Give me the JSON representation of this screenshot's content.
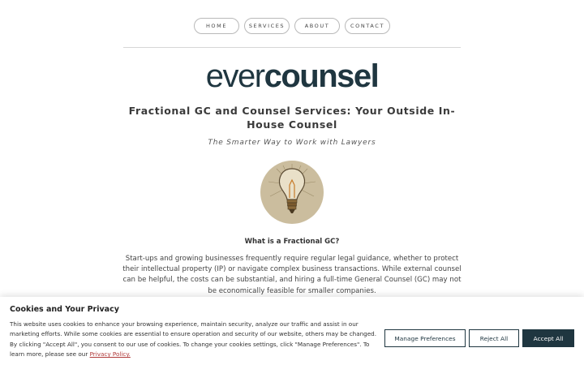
{
  "nav": {
    "home": "HOME",
    "services": "SERVICES",
    "about": "ABOUT",
    "contact": "CONTACT"
  },
  "logo": {
    "light": "ever",
    "bold": "counsel"
  },
  "hero": {
    "headline": "Fractional GC and Counsel Services: Your Outside In-House Counsel",
    "tagline": "The Smarter Way to Work with Lawyers"
  },
  "section": {
    "title": "What is a Fractional GC?",
    "body": "Start-ups and growing businesses frequently require regular legal guidance, whether to protect their intellectual property (IP) or navigate complex business transactions. While external counsel can be helpful, the costs can be substantial, and hiring a full-time General Counsel (GC) may not be economically feasible for smaller companies."
  },
  "cookie": {
    "title": "Cookies and Your Privacy",
    "text": "This website uses cookies to enhance your browsing experience, maintain security, analyze our traffic and assist in our marketing efforts. While some cookies are essential to ensure operation and security of our website, others may be changed. By clicking \"Accept All\", you consent to our use of cookies. To change your cookies settings, click \"Manage Preferences\". To learn more, please see our ",
    "link": "Privacy Policy.",
    "manage": "Manage Preferences",
    "reject": "Reject All",
    "accept": "Accept All"
  },
  "colors": {
    "brand": "#1f3640",
    "link": "#b03a3a",
    "bulb_bg": "#cbbd9e"
  }
}
